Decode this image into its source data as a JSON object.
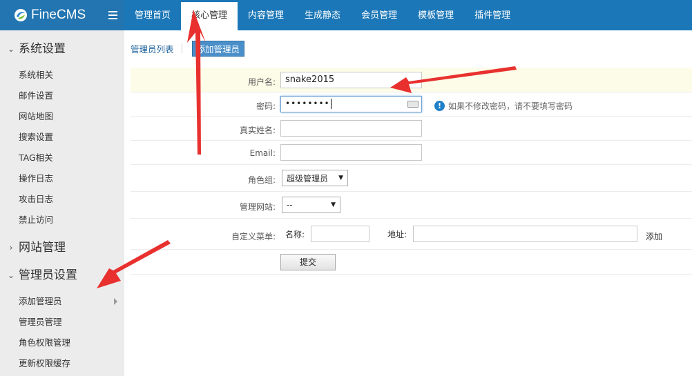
{
  "app": {
    "name": "FineCMS"
  },
  "header": {
    "nav": [
      {
        "label": "管理首页",
        "active": false
      },
      {
        "label": "核心管理",
        "active": true
      },
      {
        "label": "内容管理",
        "active": false
      },
      {
        "label": "生成静态",
        "active": false
      },
      {
        "label": "会员管理",
        "active": false
      },
      {
        "label": "模板管理",
        "active": false
      },
      {
        "label": "插件管理",
        "active": false
      }
    ]
  },
  "sidebar": {
    "groups": [
      {
        "title": "系统设置",
        "expanded": true,
        "items": [
          "系统相关",
          "邮件设置",
          "网站地图",
          "搜索设置",
          "TAG相关",
          "操作日志",
          "攻击日志",
          "禁止访问"
        ]
      },
      {
        "title": "网站管理",
        "expanded": false,
        "items": []
      },
      {
        "title": "管理员设置",
        "expanded": true,
        "items": [
          "添加管理员",
          "管理员管理",
          "角色权限管理",
          "更新权限缓存"
        ]
      }
    ]
  },
  "main": {
    "tabs": [
      {
        "label": "管理员列表",
        "active": false
      },
      {
        "label": "添加管理员",
        "active": true
      }
    ],
    "form": {
      "username": {
        "label": "用户名:",
        "value": "snake2015"
      },
      "password": {
        "label": "密码:",
        "value": "••••••••",
        "hint": "如果不修改密码，请不要填写密码"
      },
      "realname": {
        "label": "真实姓名:",
        "value": ""
      },
      "email": {
        "label": "Email:",
        "value": ""
      },
      "role": {
        "label": "角色组:",
        "selected": "超级管理员"
      },
      "site": {
        "label": "管理网站:",
        "selected": "--"
      },
      "custom_menu": {
        "label": "自定义菜单:",
        "name_label": "名称:",
        "url_label": "地址:",
        "add_label": "添加"
      },
      "submit_label": "提交"
    }
  },
  "colors": {
    "topbar": "#1b77b7",
    "sidebar": "#ececec",
    "annotation": "#e8312f"
  }
}
